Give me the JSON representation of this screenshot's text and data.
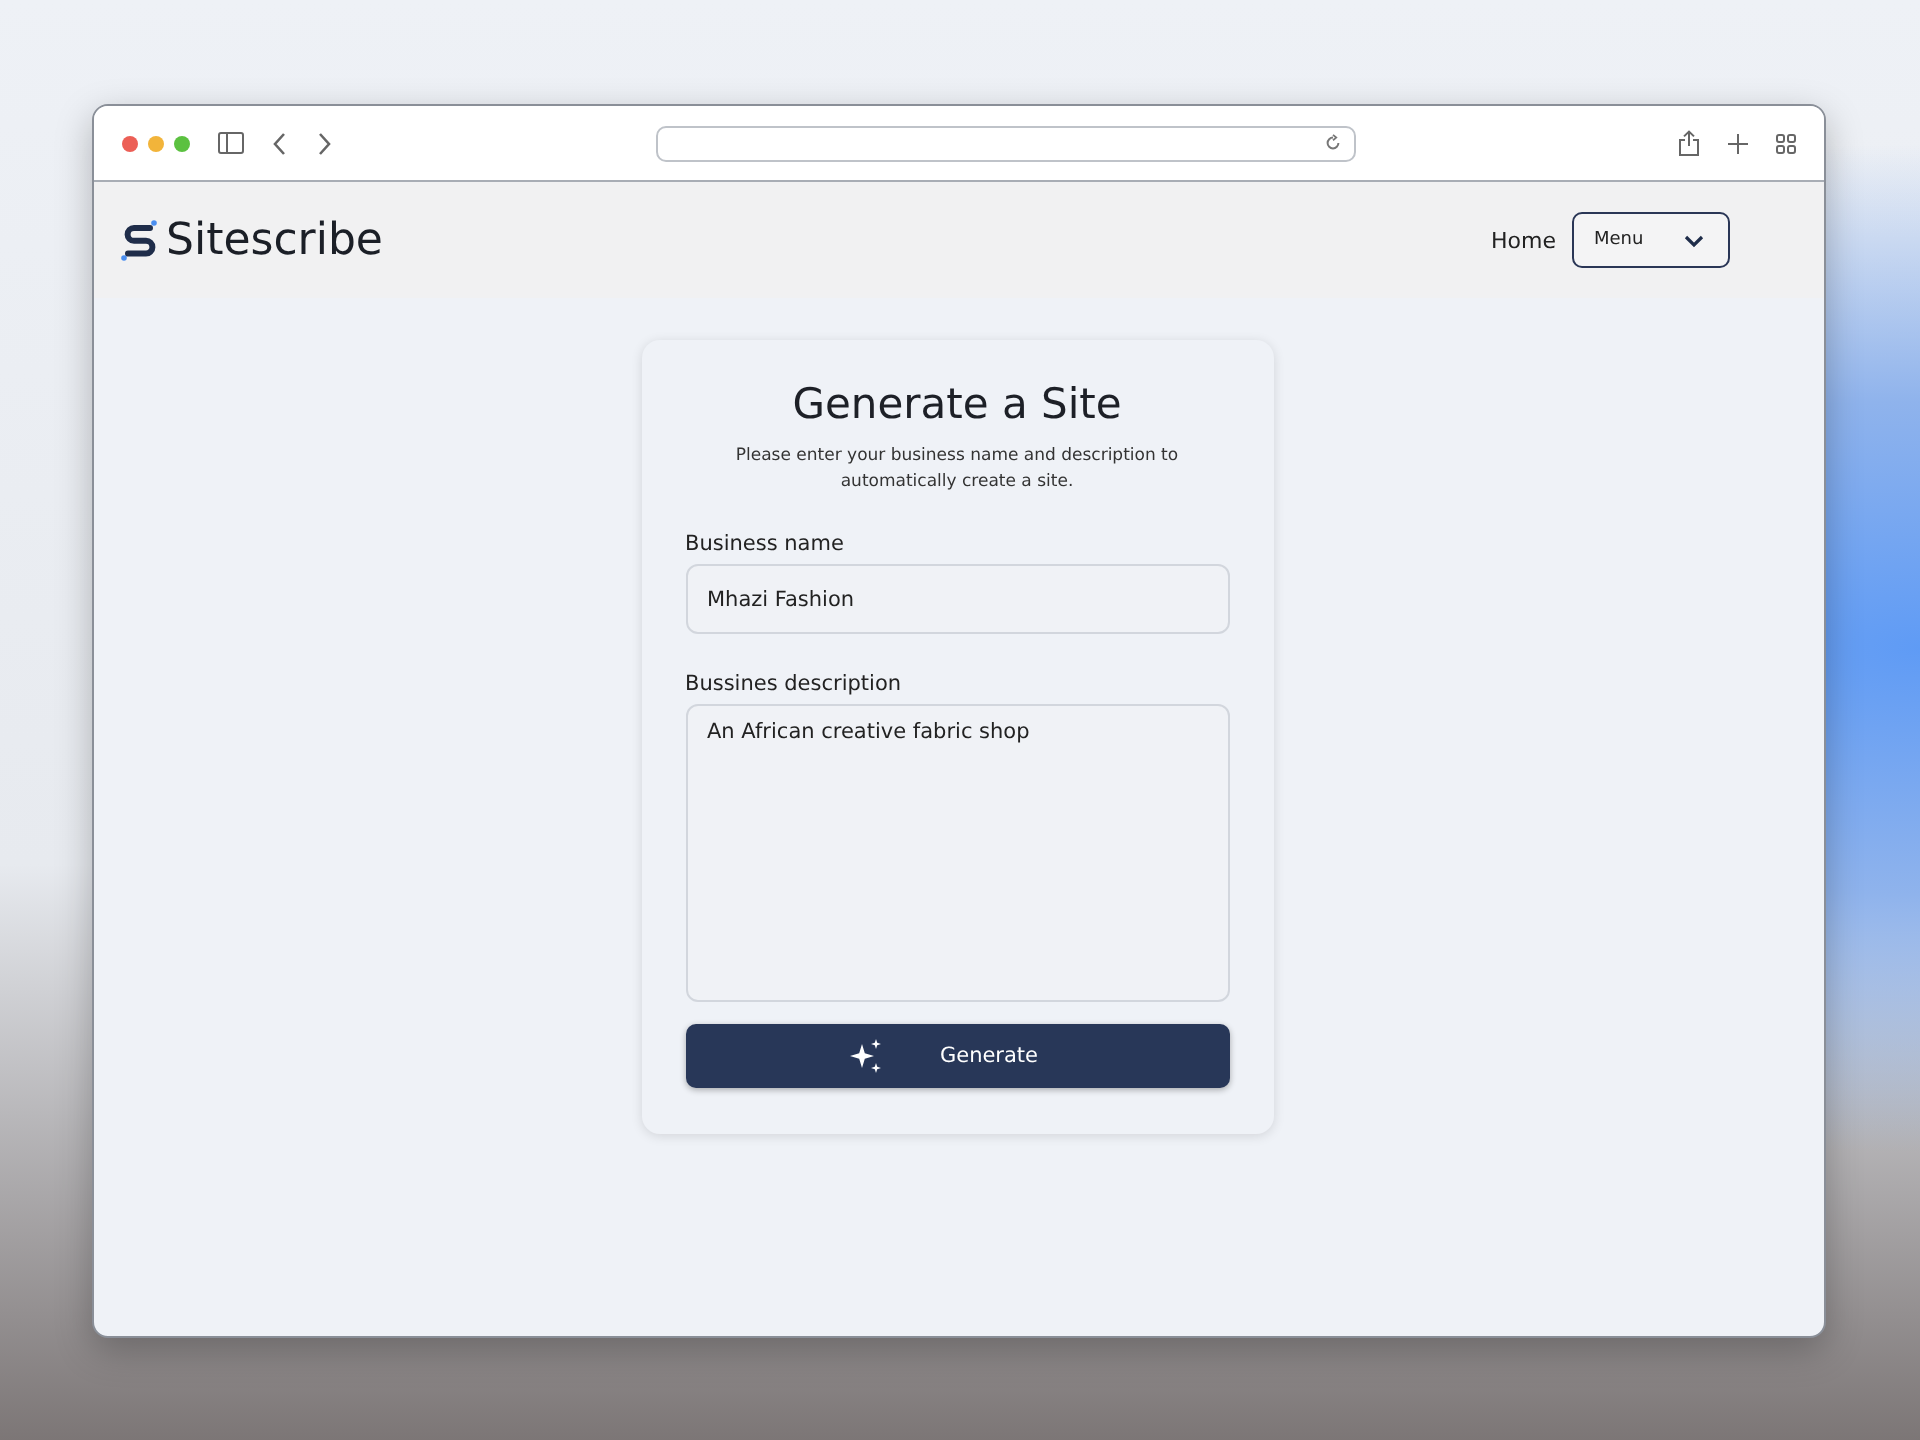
{
  "brand": {
    "name": "Sitescribe"
  },
  "nav": {
    "links": [
      "Home"
    ],
    "menu": {
      "label": "Menu"
    }
  },
  "form": {
    "title": "Generate a Site",
    "subtitle": "Please enter your business name and description to automatically create a site.",
    "fields": [
      {
        "kind": "input",
        "label": "Business name",
        "value": "Mhazi Fashion"
      },
      {
        "kind": "textarea",
        "label": "Bussines description",
        "value": "An African creative fabric shop"
      }
    ],
    "submit": "Generate"
  }
}
